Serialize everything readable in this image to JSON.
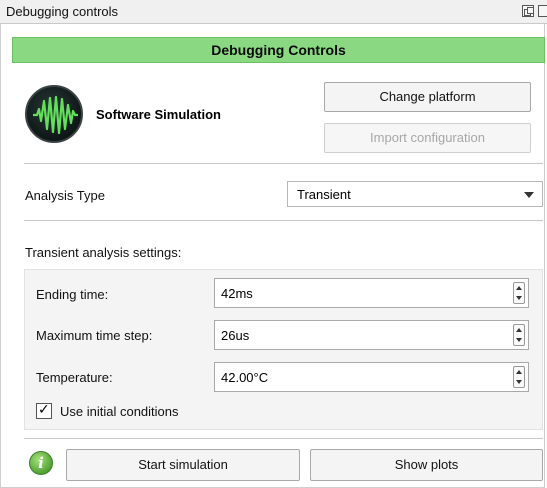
{
  "window": {
    "title": "Debugging controls"
  },
  "header": {
    "title": "Debugging Controls",
    "accent_color": "#8bd883"
  },
  "platform": {
    "icon": "waveform-icon",
    "name": "Software Simulation",
    "change_label": "Change platform",
    "import_label": "Import configuration"
  },
  "analysis": {
    "label": "Analysis Type",
    "selected": "Transient"
  },
  "transient": {
    "heading": "Transient analysis settings:",
    "ending_time": {
      "label": "Ending time:",
      "value": "42ms"
    },
    "max_step": {
      "label": "Maximum time step:",
      "value": "26us"
    },
    "temperature": {
      "label": "Temperature:",
      "value": "42.00°C"
    },
    "initial_conditions": {
      "label": "Use initial conditions",
      "checked": true
    }
  },
  "footer": {
    "info_icon": "info-icon",
    "start_label": "Start simulation",
    "plots_label": "Show plots"
  }
}
